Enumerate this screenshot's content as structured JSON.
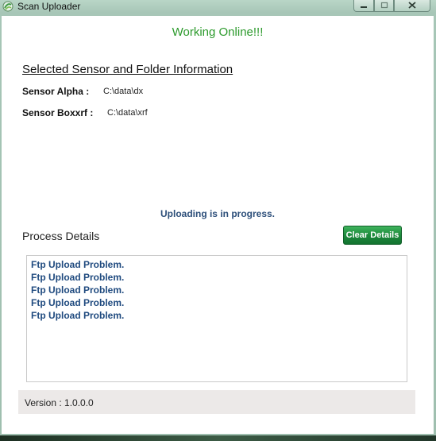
{
  "window": {
    "title": "Scan Uploader"
  },
  "status": {
    "online_text": "Working Online!!!",
    "upload_text": "Uploading is in progress."
  },
  "sensor_section": {
    "title": "Selected Sensor and Folder Information",
    "sensors": [
      {
        "label": "Sensor Alpha :",
        "path": "C:\\data\\dx"
      },
      {
        "label": "Sensor Boxxrf :",
        "path": "C:\\data\\xrf"
      }
    ]
  },
  "process": {
    "title": "Process Details",
    "clear_label": "Clear Details",
    "log": [
      "Ftp Upload Problem.",
      "Ftp Upload Problem.",
      "Ftp Upload Problem.",
      "Ftp Upload Problem.",
      "Ftp Upload Problem."
    ]
  },
  "footer": {
    "version_text": "Version : 1.0.0.0"
  },
  "colors": {
    "online_green": "#2c9a2c",
    "upload_blue": "#2d4f7a",
    "button_green": "#1d8a3c",
    "log_blue": "#1f4a7f"
  },
  "icons": {
    "app": "app-logo-icon",
    "minimize": "minimize-icon",
    "maximize": "maximize-icon",
    "close": "close-icon"
  }
}
